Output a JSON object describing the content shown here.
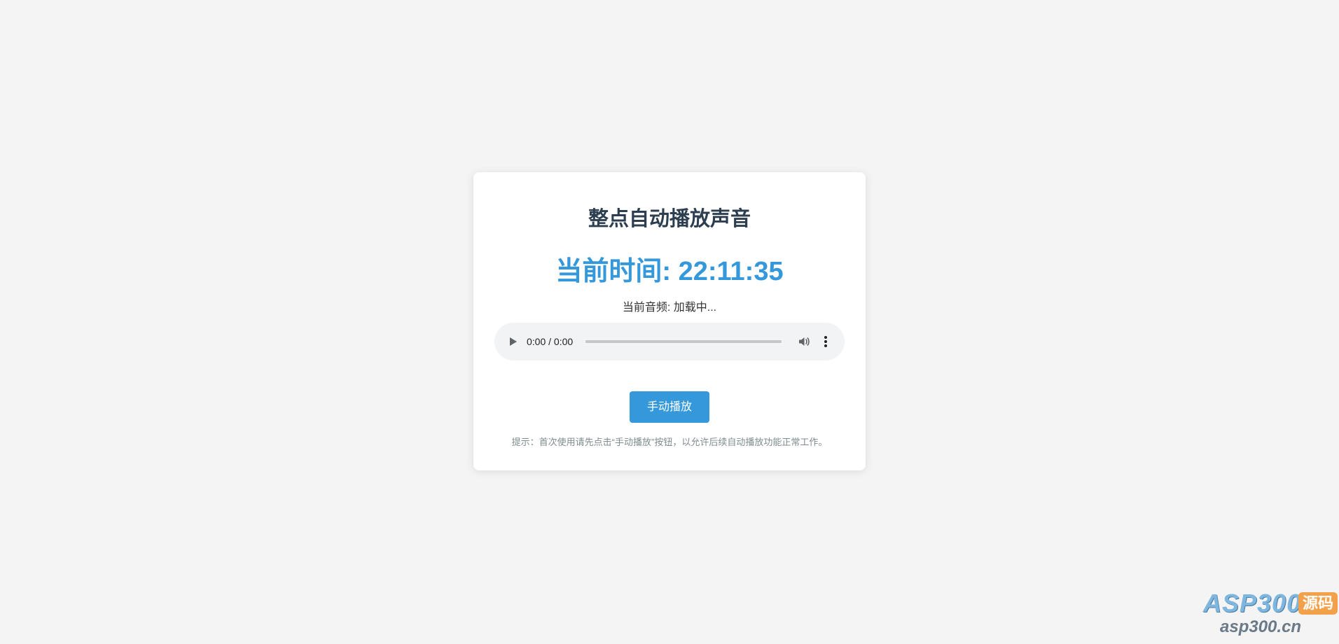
{
  "page": {
    "title": "整点自动播放声音"
  },
  "clock": {
    "label": "当前时间: ",
    "time": "22:11:35"
  },
  "audio": {
    "info_label": "当前音频: ",
    "info_value": "加载中...",
    "time_display": "0:00 / 0:00",
    "progress": 0
  },
  "controls": {
    "manual_play_label": "手动播放"
  },
  "hint": {
    "text": "提示：首次使用请先点击“手动播放”按钮，以允许后续自动播放功能正常工作。"
  },
  "watermark": {
    "brand": "ASP300",
    "badge": "源码",
    "domain": "asp300.cn"
  },
  "colors": {
    "accent": "#3498db",
    "title": "#2c3e50",
    "background": "#f4f4f4"
  },
  "icons": {
    "play": "play-icon",
    "volume": "volume-icon",
    "more": "more-vertical-icon"
  }
}
